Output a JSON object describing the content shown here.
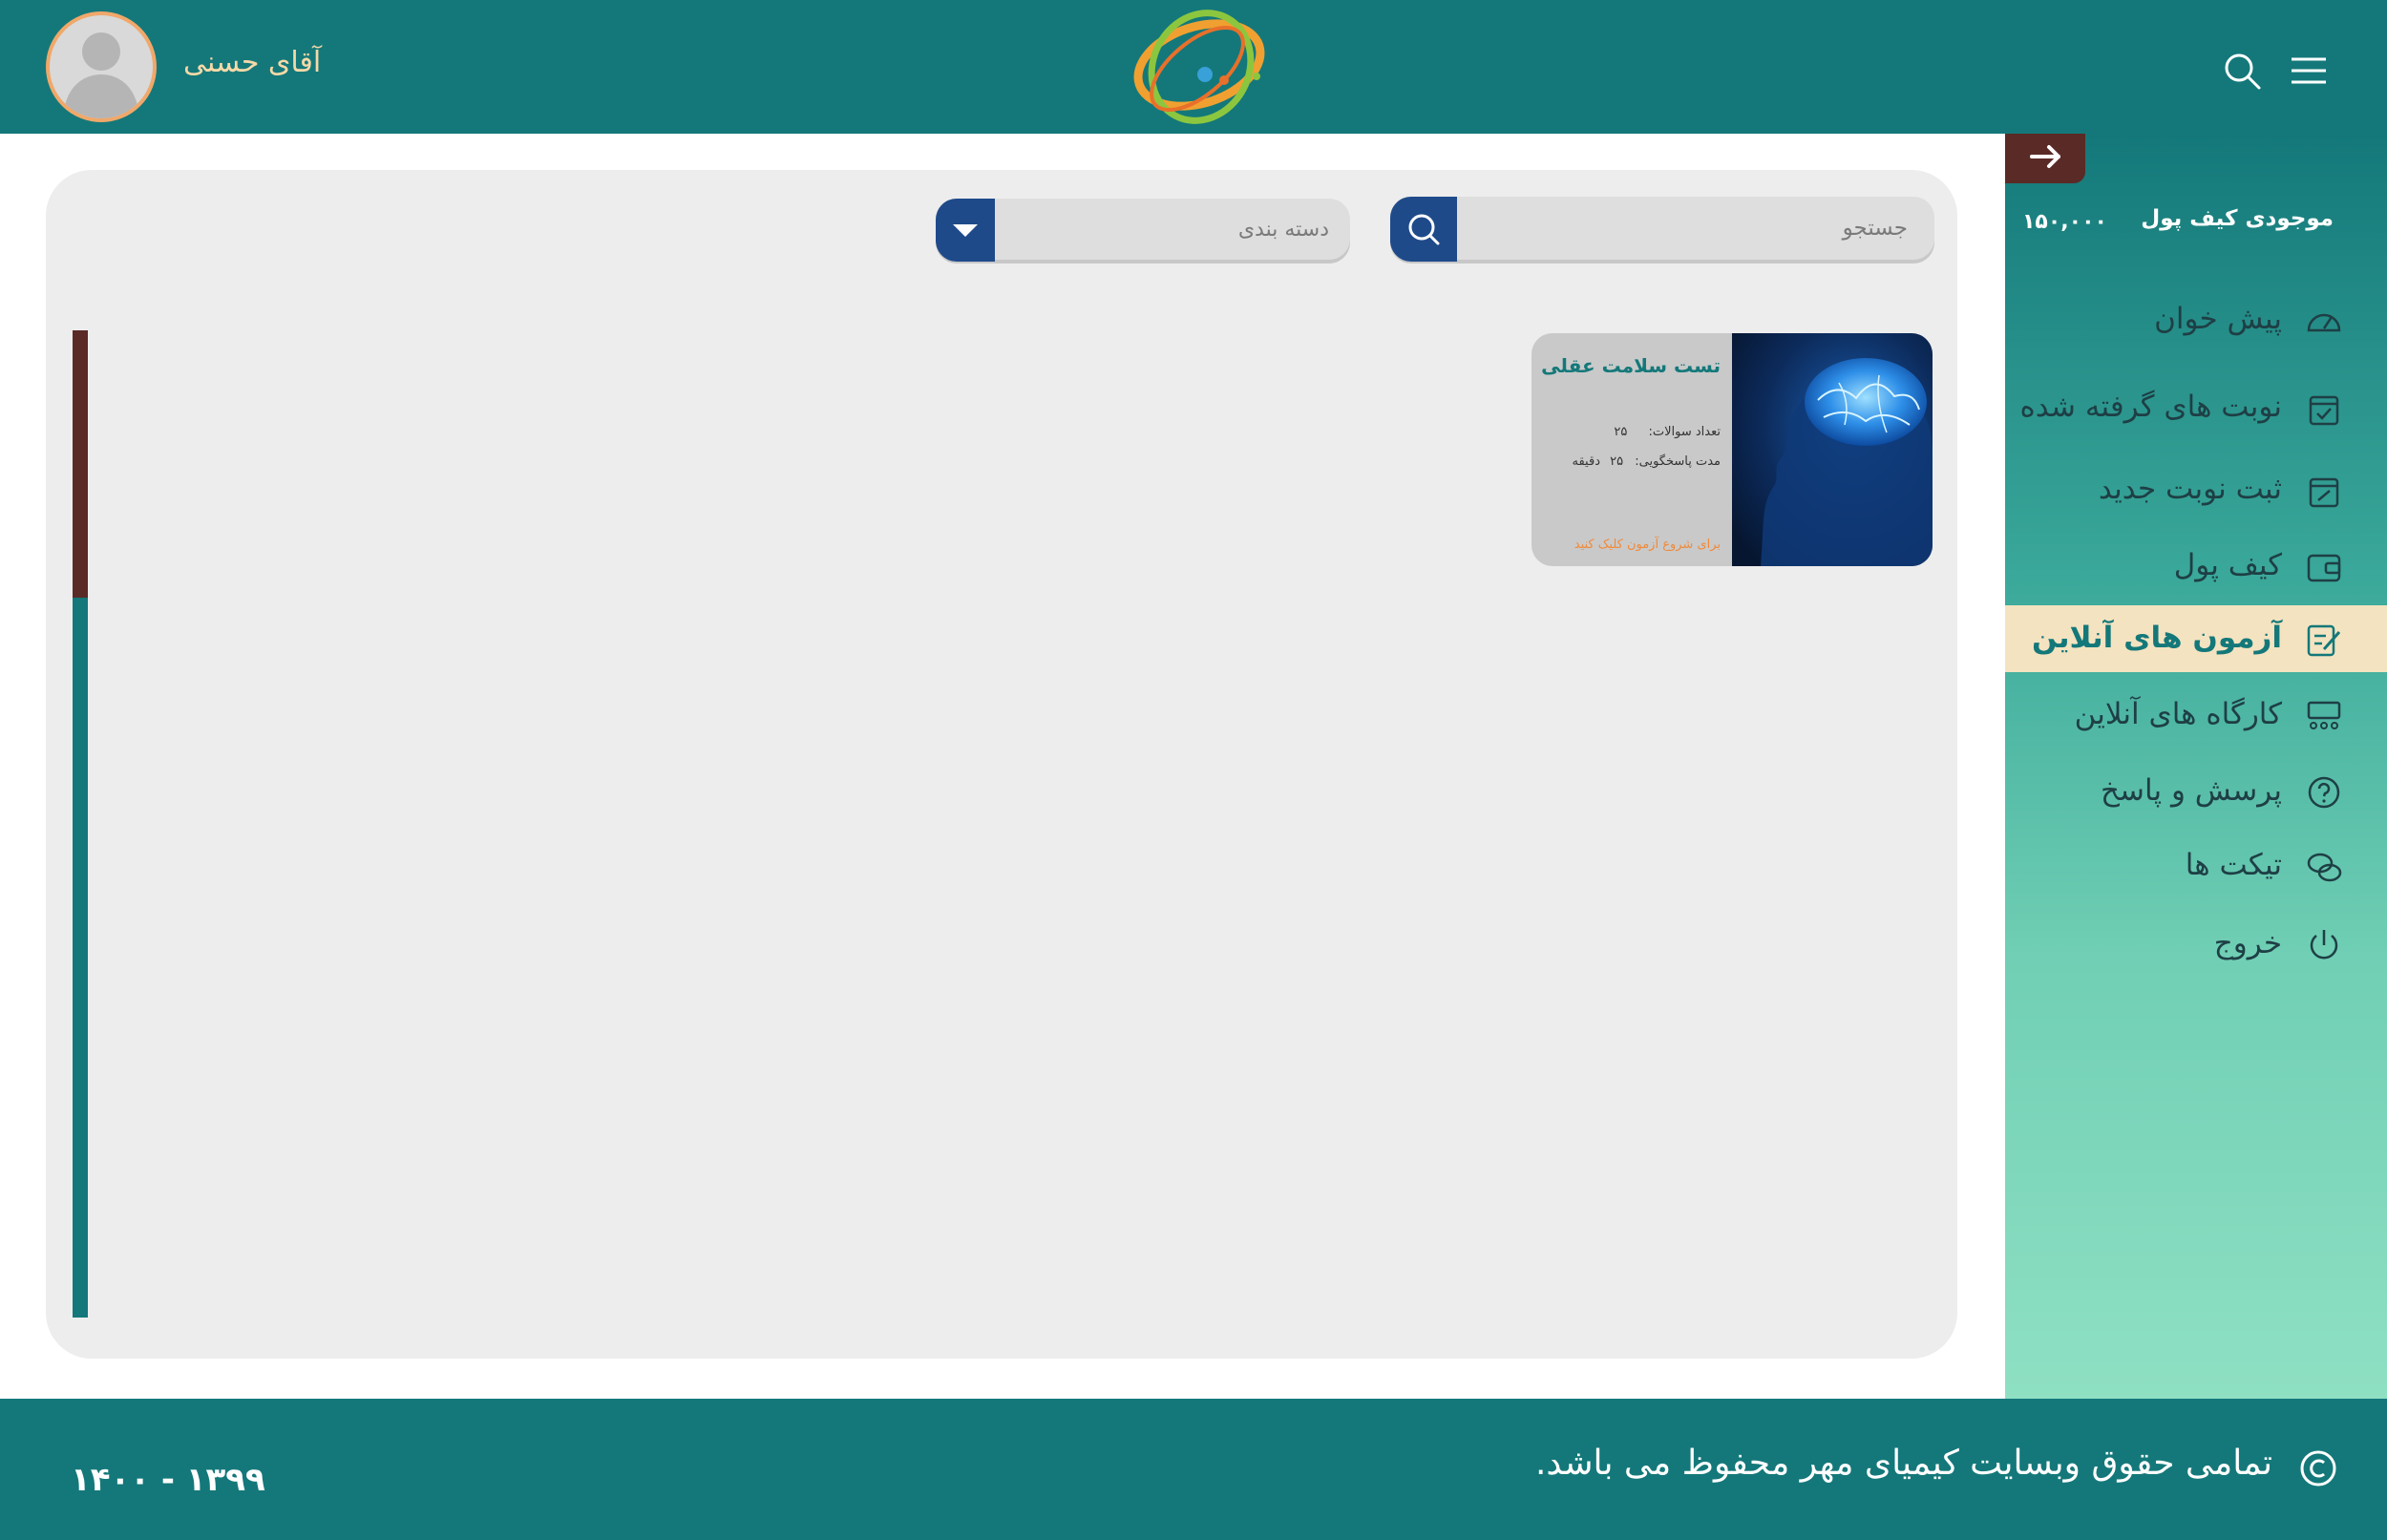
{
  "header": {
    "user_name": "آقای حسنی"
  },
  "wallet": {
    "label": "موجودی کیف پول",
    "value": "۱۵۰,۰۰۰"
  },
  "sidebar": {
    "items": [
      {
        "label": "پیش خوان",
        "icon": "dashboard-icon"
      },
      {
        "label": "نوبت های گرفته شده",
        "icon": "calendar-check-icon"
      },
      {
        "label": "ثبت نوبت جدید",
        "icon": "calendar-edit-icon"
      },
      {
        "label": "کیف پول",
        "icon": "wallet-icon"
      },
      {
        "label": "آزمون های آنلاین",
        "icon": "exam-icon",
        "active": true
      },
      {
        "label": "کارگاه های آنلاین",
        "icon": "workshop-icon"
      },
      {
        "label": "پرسش و پاسخ",
        "icon": "question-icon"
      },
      {
        "label": "تیکت ها",
        "icon": "chat-icon"
      },
      {
        "label": "خروج",
        "icon": "power-icon"
      }
    ]
  },
  "filters": {
    "search_placeholder": "جستجو",
    "category_placeholder": "دسته بندی"
  },
  "exam_card": {
    "title": "تست سلامت عقلی",
    "questions_label": "تعداد سوالات:",
    "questions_value": "۲۵",
    "duration_label": "مدت پاسخگویی:",
    "duration_value": "۲۵",
    "duration_unit": "دقیقه",
    "cta": "برای شروع آزمون کلیک کنید"
  },
  "footer": {
    "copyright": "تمامی حقوق وبسایت کیمیای مهر محفوظ می باشد.",
    "years": "۱۴۰۰ - ۱۳۹۹"
  },
  "colors": {
    "primary": "#14787a",
    "accent_dark": "#5a2a26",
    "active_bg": "#f4e3c0",
    "button_blue": "#1f4a8a",
    "cta_orange": "#f08a3a"
  }
}
